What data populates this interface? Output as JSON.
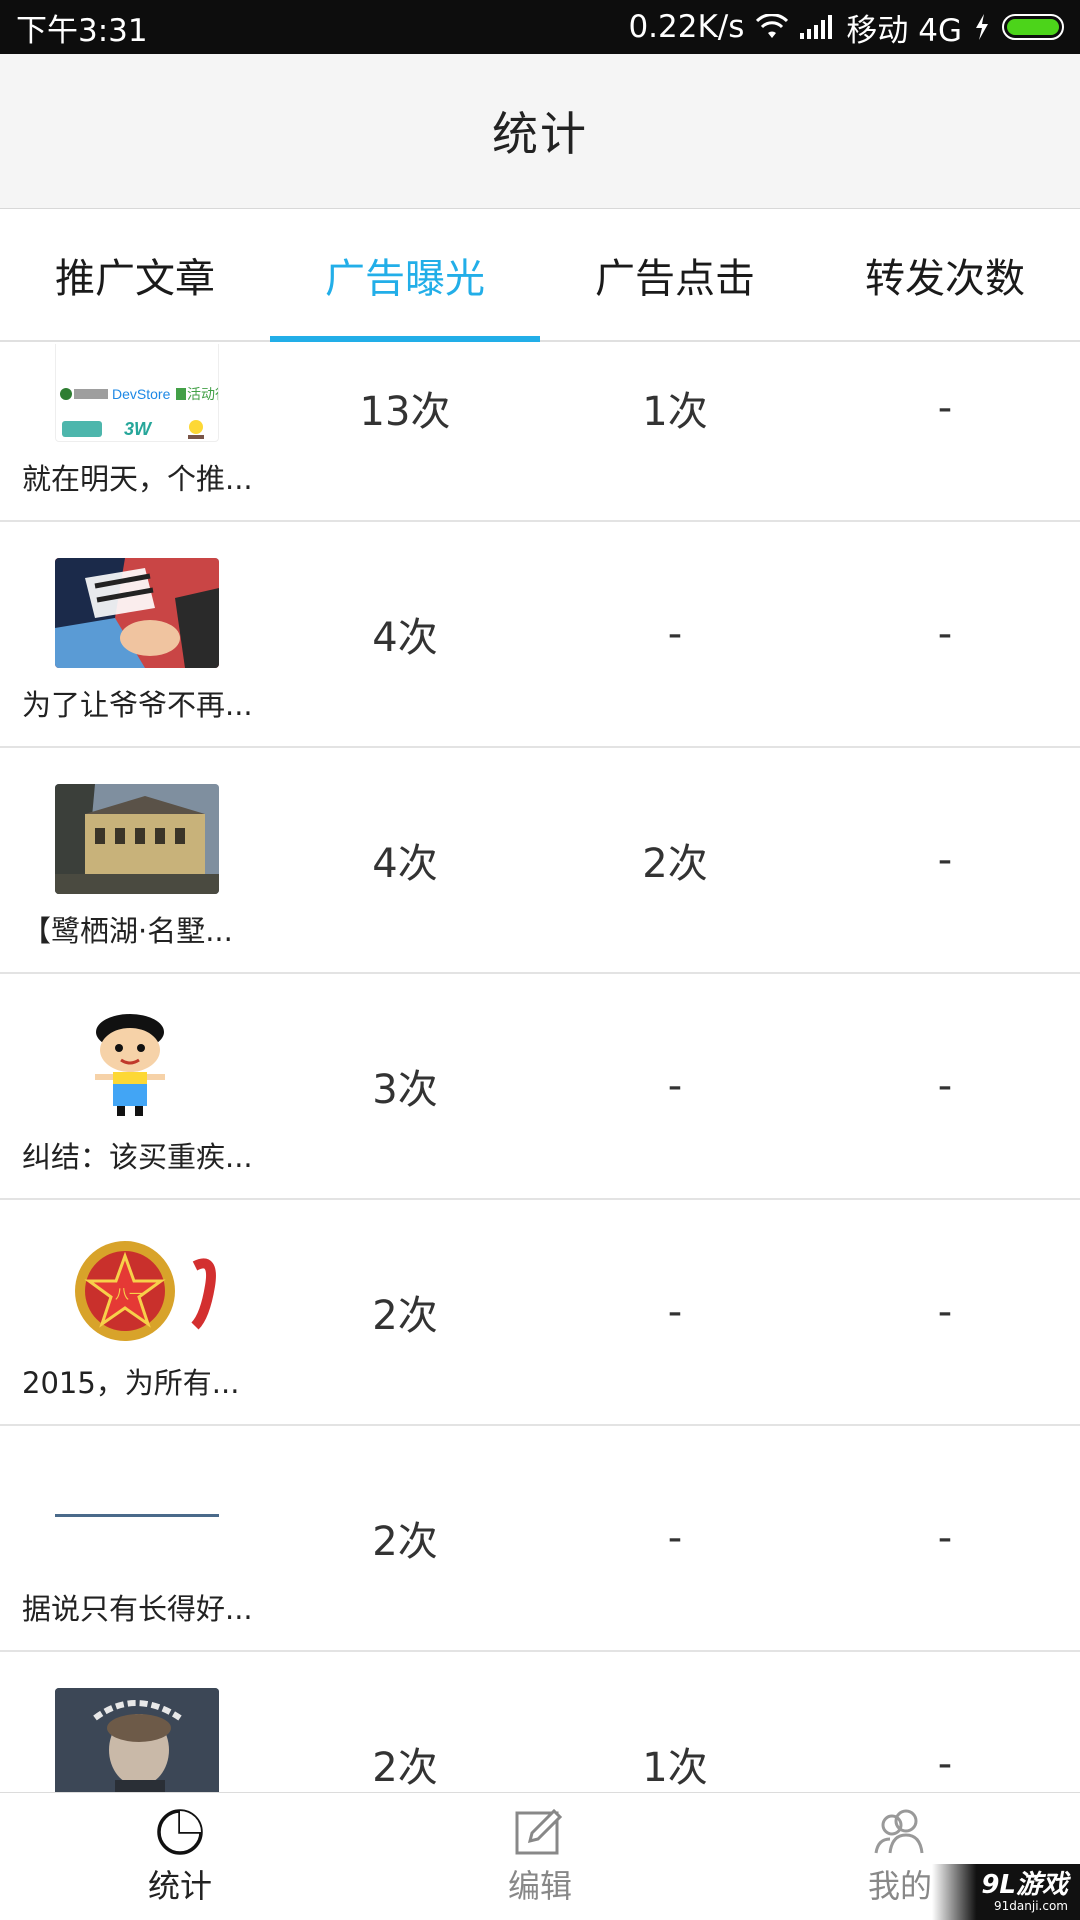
{
  "status_bar": {
    "time": "下午3:31",
    "speed": "0.22K/s",
    "carrier": "移动 4G",
    "battery_color": "#4cd41a"
  },
  "header": {
    "title": "统计"
  },
  "tabs": [
    {
      "label": "推广文章",
      "active": false
    },
    {
      "label": "广告曝光",
      "active": true
    },
    {
      "label": "广告点击",
      "active": false
    },
    {
      "label": "转发次数",
      "active": false
    }
  ],
  "accent_color": "#22aee8",
  "rows": [
    {
      "title": "就在明天，个推...",
      "exposure": "13次",
      "clicks": "1次",
      "shares": "-",
      "thumb": "logos-collage",
      "thumb_text": {
        "devstore": "DevStore",
        "activity": "活动行",
        "w3": "3W"
      }
    },
    {
      "title": "为了让爷爷不再...",
      "exposure": "4次",
      "clicks": "-",
      "shares": "-",
      "thumb": "family-photo"
    },
    {
      "title": "【鹭栖湖·名墅...",
      "exposure": "4次",
      "clicks": "2次",
      "shares": "-",
      "thumb": "villa-photo"
    },
    {
      "title": "纠结：该买重疾...",
      "exposure": "3次",
      "clicks": "-",
      "shares": "-",
      "thumb": "cartoon-boy"
    },
    {
      "title": "2015，为所有...",
      "exposure": "2次",
      "clicks": "-",
      "shares": "-",
      "thumb": "army-emblem",
      "thumb_text": {
        "emblem": "八一"
      }
    },
    {
      "title": "据说只有长得好...",
      "exposure": "2次",
      "clicks": "-",
      "shares": "-",
      "thumb": "blank-line"
    },
    {
      "title": "",
      "exposure": "2次",
      "clicks": "1次",
      "shares": "-",
      "thumb": "man-laurel"
    }
  ],
  "bottom_nav": [
    {
      "label": "统计",
      "icon": "pie-chart-icon",
      "active": true
    },
    {
      "label": "编辑",
      "icon": "edit-icon",
      "active": false
    },
    {
      "label": "我的",
      "icon": "users-icon",
      "active": false
    }
  ],
  "watermark": {
    "main": "9L游戏",
    "sub": "91danji.com"
  }
}
